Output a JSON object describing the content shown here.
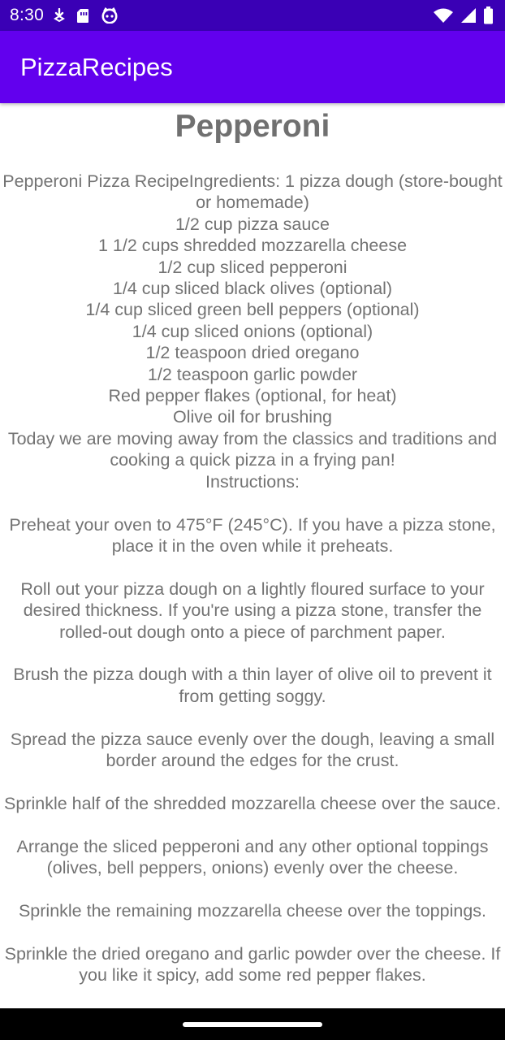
{
  "status_bar": {
    "time": "8:30",
    "left_icons": [
      "download-icon",
      "sim-card-icon",
      "app-notification-icon"
    ],
    "right_icons": [
      "wifi-icon",
      "cell-signal-icon",
      "battery-icon"
    ]
  },
  "app_bar": {
    "title": "PizzaRecipes"
  },
  "recipe": {
    "title": "Pepperoni",
    "body": "Pepperoni Pizza RecipeIngredients: 1 pizza dough (store-bought or homemade)\n1/2 cup pizza sauce\n1 1/2 cups shredded mozzarella cheese\n1/2 cup sliced pepperoni\n1/4 cup sliced black olives (optional)\n1/4 cup sliced green bell peppers (optional)\n1/4 cup sliced onions (optional)\n1/2 teaspoon dried oregano\n1/2 teaspoon garlic powder\nRed pepper flakes (optional, for heat)\nOlive oil for brushing\nToday we are moving away from the classics and traditions and cooking a quick pizza in a frying pan!\nInstructions:\n\nPreheat your oven to 475°F (245°C). If you have a pizza stone, place it in the oven while it preheats.\n\nRoll out your pizza dough on a lightly floured surface to your desired thickness. If you're using a pizza stone, transfer the rolled-out dough onto a piece of parchment paper.\n\nBrush the pizza dough with a thin layer of olive oil to prevent it from getting soggy.\n\nSpread the pizza sauce evenly over the dough, leaving a small border around the edges for the crust.\n\nSprinkle half of the shredded mozzarella cheese over the sauce.\n\nArrange the sliced pepperoni and any other optional toppings (olives, bell peppers, onions) evenly over the cheese.\n\nSprinkle the remaining mozzarella cheese over the toppings.\n\nSprinkle the dried oregano and garlic powder over the cheese. If you like it spicy, add some red pepper flakes."
  },
  "colors": {
    "status_bar": "#3a00b5",
    "app_bar": "#6200ee",
    "text": "#737373"
  }
}
